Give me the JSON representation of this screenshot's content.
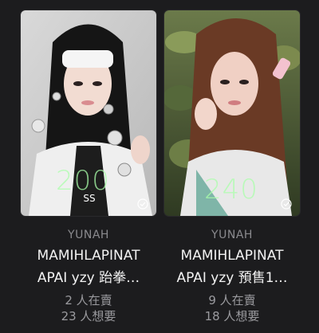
{
  "cards": [
    {
      "photo_number": "200",
      "artist": "YUNAH",
      "title_line1": "MAMIHLAPINAT",
      "title_line2": "APAI yzy 跆拳…",
      "selling": "2 人在賣",
      "wanting": "23 人想要"
    },
    {
      "photo_number": "240",
      "artist": "YUNAH",
      "title_line1": "MAMIHLAPINAT",
      "title_line2": "APAI yzy 預售1…",
      "selling": "9 人在賣",
      "wanting": "18 人想要"
    }
  ]
}
